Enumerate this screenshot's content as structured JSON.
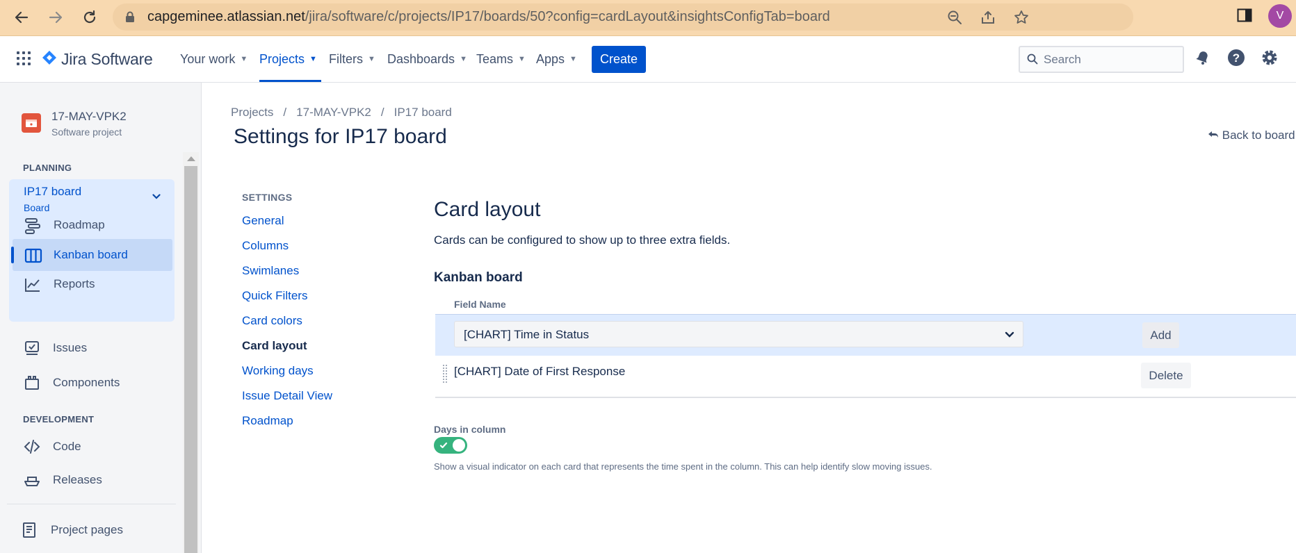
{
  "browser": {
    "url_host": "capgeminee.atlassian.net",
    "url_path": "/jira/software/c/projects/IP17/boards/50?config=cardLayout&insightsConfigTab=board",
    "profile_initial": "V",
    "accent": "#f8d9b0"
  },
  "topnav": {
    "product": "Jira Software",
    "menus": [
      "Your work",
      "Projects",
      "Filters",
      "Dashboards",
      "Teams",
      "Apps"
    ],
    "active_menu": "Projects",
    "create_label": "Create",
    "search_placeholder": "Search",
    "brand_color": "#0052cc"
  },
  "sidebar": {
    "project_name": "17-MAY-VPK2",
    "project_type": "Software project",
    "planning_label": "PLANNING",
    "board_title": "IP17 board",
    "board_subtitle": "Board",
    "board_items": [
      {
        "label": "Roadmap",
        "icon": "roadmap-icon"
      },
      {
        "label": "Kanban board",
        "icon": "kanban-board-icon",
        "selected": true
      },
      {
        "label": "Reports",
        "icon": "reports-icon"
      }
    ],
    "items": [
      {
        "label": "Issues",
        "icon": "issues-icon"
      },
      {
        "label": "Components",
        "icon": "components-icon"
      }
    ],
    "development_label": "DEVELOPMENT",
    "dev_items": [
      {
        "label": "Code",
        "icon": "code-icon"
      },
      {
        "label": "Releases",
        "icon": "releases-icon"
      }
    ],
    "project_pages": "Project pages"
  },
  "main": {
    "breadcrumb": [
      "Projects",
      "17-MAY-VPK2",
      "IP17 board"
    ],
    "breadcrumb_sep": "/",
    "title": "Settings for IP17 board",
    "back_link": "Back to board",
    "settings_label": "SETTINGS",
    "settings_links": [
      "General",
      "Columns",
      "Swimlanes",
      "Quick Filters",
      "Card colors",
      "Card layout",
      "Working days",
      "Issue Detail View",
      "Roadmap"
    ],
    "current_setting": "Card layout",
    "card_layout": {
      "title": "Card layout",
      "description": "Cards can be configured to show up to three extra fields.",
      "board_heading": "Kanban board",
      "column_header": "Field Name",
      "select_value": "[CHART] Time in Status",
      "add_label": "Add",
      "fields": [
        {
          "name": "[CHART] Date of First Response",
          "action": "Delete"
        }
      ]
    },
    "days_in_column": {
      "label": "Days in column",
      "enabled": true,
      "help": "Show a visual indicator on each card that represents the time spent in the column. This can help identify slow moving issues.",
      "toggle_color": "#36b37e"
    }
  }
}
